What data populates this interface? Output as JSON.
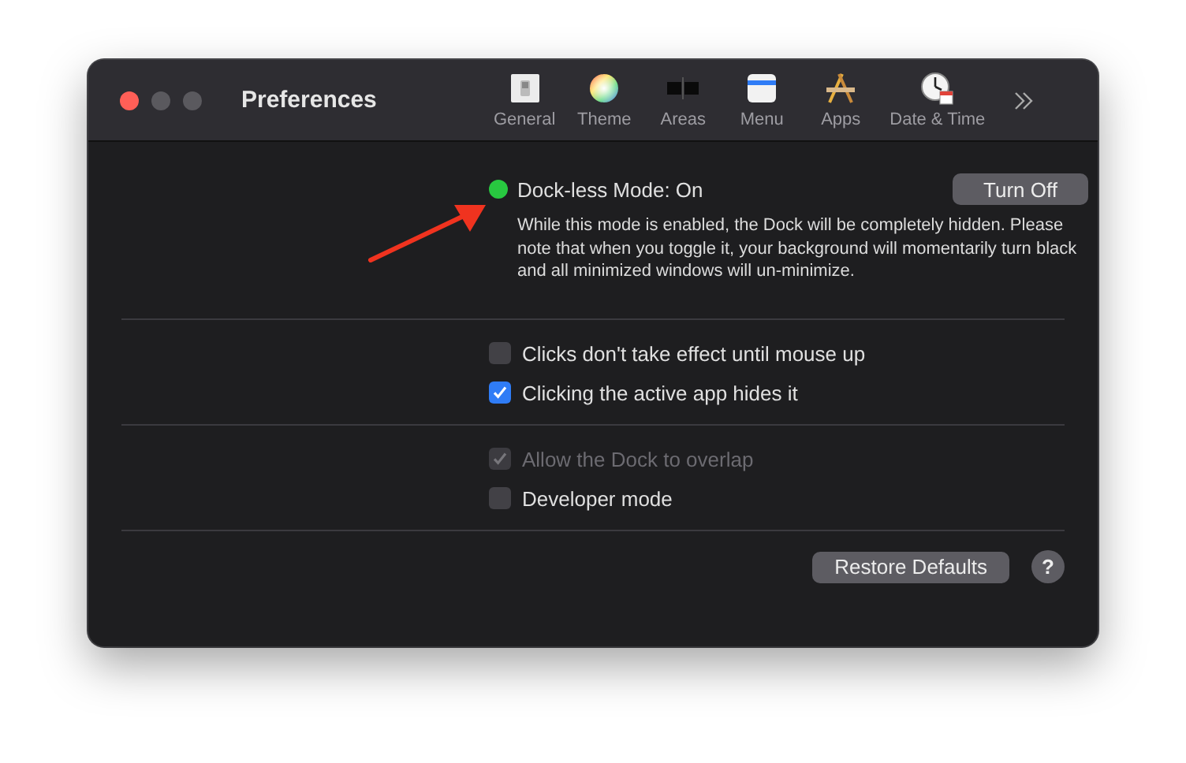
{
  "window": {
    "title": "Preferences",
    "traffic_lights": [
      {
        "kind": "close",
        "disabled": false
      },
      {
        "kind": "minimize",
        "disabled": true
      },
      {
        "kind": "zoom",
        "disabled": true
      }
    ]
  },
  "toolbar": {
    "items": [
      {
        "kind": "general",
        "label": "General",
        "selected": false
      },
      {
        "kind": "theme",
        "label": "Theme",
        "selected": false
      },
      {
        "kind": "areas",
        "label": "Areas",
        "selected": false
      },
      {
        "kind": "menu",
        "label": "Menu",
        "selected": false
      },
      {
        "kind": "apps",
        "label": "Apps",
        "selected": false
      },
      {
        "kind": "datetime",
        "label": "Date & Time",
        "selected": false
      }
    ]
  },
  "status": {
    "label": "Dock-less Mode: On",
    "on": true,
    "description": "While this mode is enabled, the Dock will be completely hidden. Please note that when you toggle it, your background will momentarily turn black and all minimized windows will un-minimize.",
    "button": "Turn Off"
  },
  "option_groups": [
    [
      {
        "label": "Clicks don't take effect until mouse up",
        "checked": false,
        "disabled": false
      },
      {
        "label": "Clicking the active app hides it",
        "checked": true,
        "disabled": false
      }
    ],
    [
      {
        "label": "Allow the Dock to overlap",
        "checked": true,
        "disabled": true
      },
      {
        "label": "Developer mode",
        "checked": false,
        "disabled": false
      }
    ]
  ],
  "footer": {
    "button": "Restore Defaults",
    "help": "?"
  }
}
